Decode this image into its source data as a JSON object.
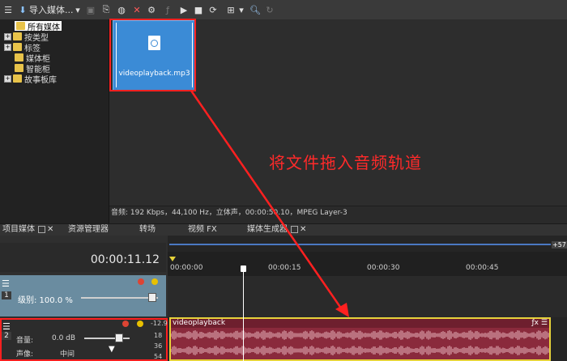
{
  "toolbar": {
    "import_label": "导入媒体...",
    "dropdown_arrow": "▾"
  },
  "tree": {
    "items": [
      {
        "label": "所有媒体",
        "selected": true
      },
      {
        "label": "按类型"
      },
      {
        "label": "标签"
      },
      {
        "label": "媒体柜"
      },
      {
        "label": "智能柜"
      },
      {
        "label": "故事板库"
      }
    ]
  },
  "media": {
    "clip_name": "videoplayback.mp3",
    "status": "音频: 192 Kbps，44,100 Hz，立体声，00:00:50.10，MPEG Layer-3",
    "annotation": "将文件拖入音频轨道"
  },
  "tabs": [
    {
      "label": "项目媒体"
    },
    {
      "label": "资源管理器"
    },
    {
      "label": "转场"
    },
    {
      "label": "视频 FX"
    },
    {
      "label": "媒体生成器"
    }
  ],
  "timeline": {
    "timecode": "00:00:11.12",
    "ruler_labels": [
      "00:00:00",
      "00:00:15",
      "00:00:30",
      "00:00:45"
    ],
    "plus_label": "+57",
    "track1": {
      "number": "1",
      "level_label": "级别: 100.0 %"
    },
    "track2": {
      "number": "2",
      "volume_label": "音量:",
      "volume_value": "0.0 dB",
      "pan_label": "声像:",
      "pan_value": "中间",
      "db_marks": [
        "-12.9",
        "18",
        "36",
        "54"
      ],
      "clip_title": "videoplayback"
    }
  },
  "colors": {
    "accent": "#3b8bd6",
    "annotation_red": "#ff2a2a",
    "audio_clip": "#8a2a3c",
    "audio_border": "#e6d23a",
    "video_track": "#6a8ca0"
  }
}
